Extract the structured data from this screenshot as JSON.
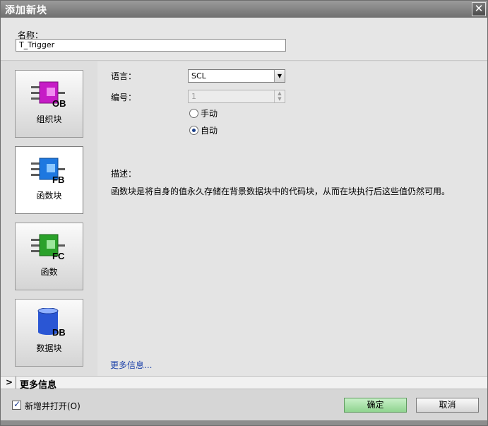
{
  "window": {
    "title": "添加新块",
    "close_glyph": "✕"
  },
  "name_field": {
    "label": "名称：",
    "value": "T_Trigger"
  },
  "block_types": [
    {
      "label": "组织块",
      "badge": "OB",
      "color": "#c61cc6",
      "icon": "ob-block-icon"
    },
    {
      "label": "函数块",
      "badge": "FB",
      "color": "#1e78e0",
      "icon": "fb-block-icon"
    },
    {
      "label": "函数",
      "badge": "FC",
      "color": "#2aa12a",
      "icon": "fc-block-icon"
    },
    {
      "label": "数据块",
      "badge": "DB",
      "color": "#2a56d4",
      "icon": "db-block-icon"
    }
  ],
  "form": {
    "language_label": "语言：",
    "language_value": "SCL",
    "number_label": "编号：",
    "number_value": "1",
    "manual_label": "手动",
    "auto_label": "自动",
    "description_label": "描述：",
    "description_text": "函数块是将自身的值永久存储在背景数据块中的代码块，从而在块执行后这些值仍然可用。",
    "more_link": "更多信息..."
  },
  "more_info_bar": {
    "chevron": ">",
    "label": "更多信息"
  },
  "footer": {
    "add_open_label": "新增并打开(O)",
    "ok_label": "确定",
    "cancel_label": "取消"
  }
}
